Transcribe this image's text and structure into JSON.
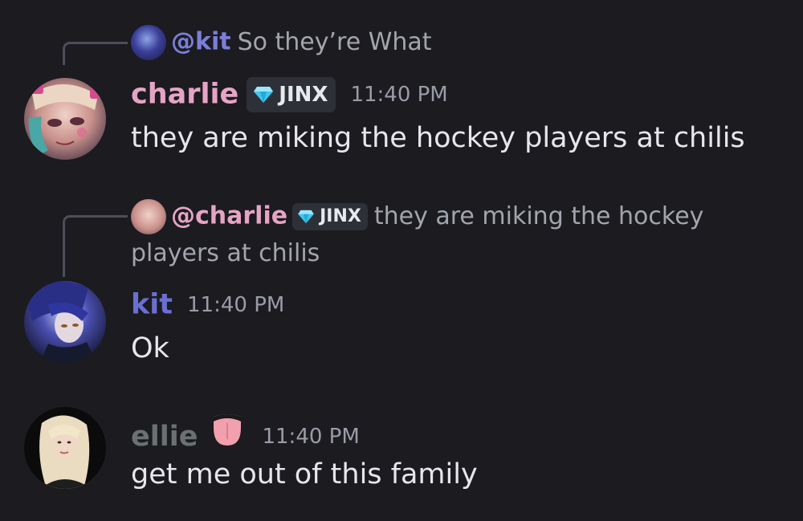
{
  "messages": [
    {
      "reply": {
        "mention": "@kit",
        "mention_color": "#7b7fd8",
        "text": "So they’re What"
      },
      "author": "charlie",
      "author_color": "#e6a4c5",
      "tag": "JINX",
      "tag_icon": "diamond-icon",
      "time": "11:40 PM",
      "text": "they are miking the hockey players at chilis"
    },
    {
      "reply": {
        "mention": "@charlie",
        "mention_color": "#e6a4c5",
        "tag": "JINX",
        "text_line1": "they are miking the hockey",
        "text_line2": "players at chilis"
      },
      "author": "kit",
      "author_color": "#6a6fd0",
      "time": "11:40 PM",
      "text": "Ok"
    },
    {
      "author": "ellie",
      "author_color": "#6b7072",
      "author_icon": "tongue-emoji-icon",
      "time": "11:40 PM",
      "text": "get me out of this family"
    }
  ]
}
